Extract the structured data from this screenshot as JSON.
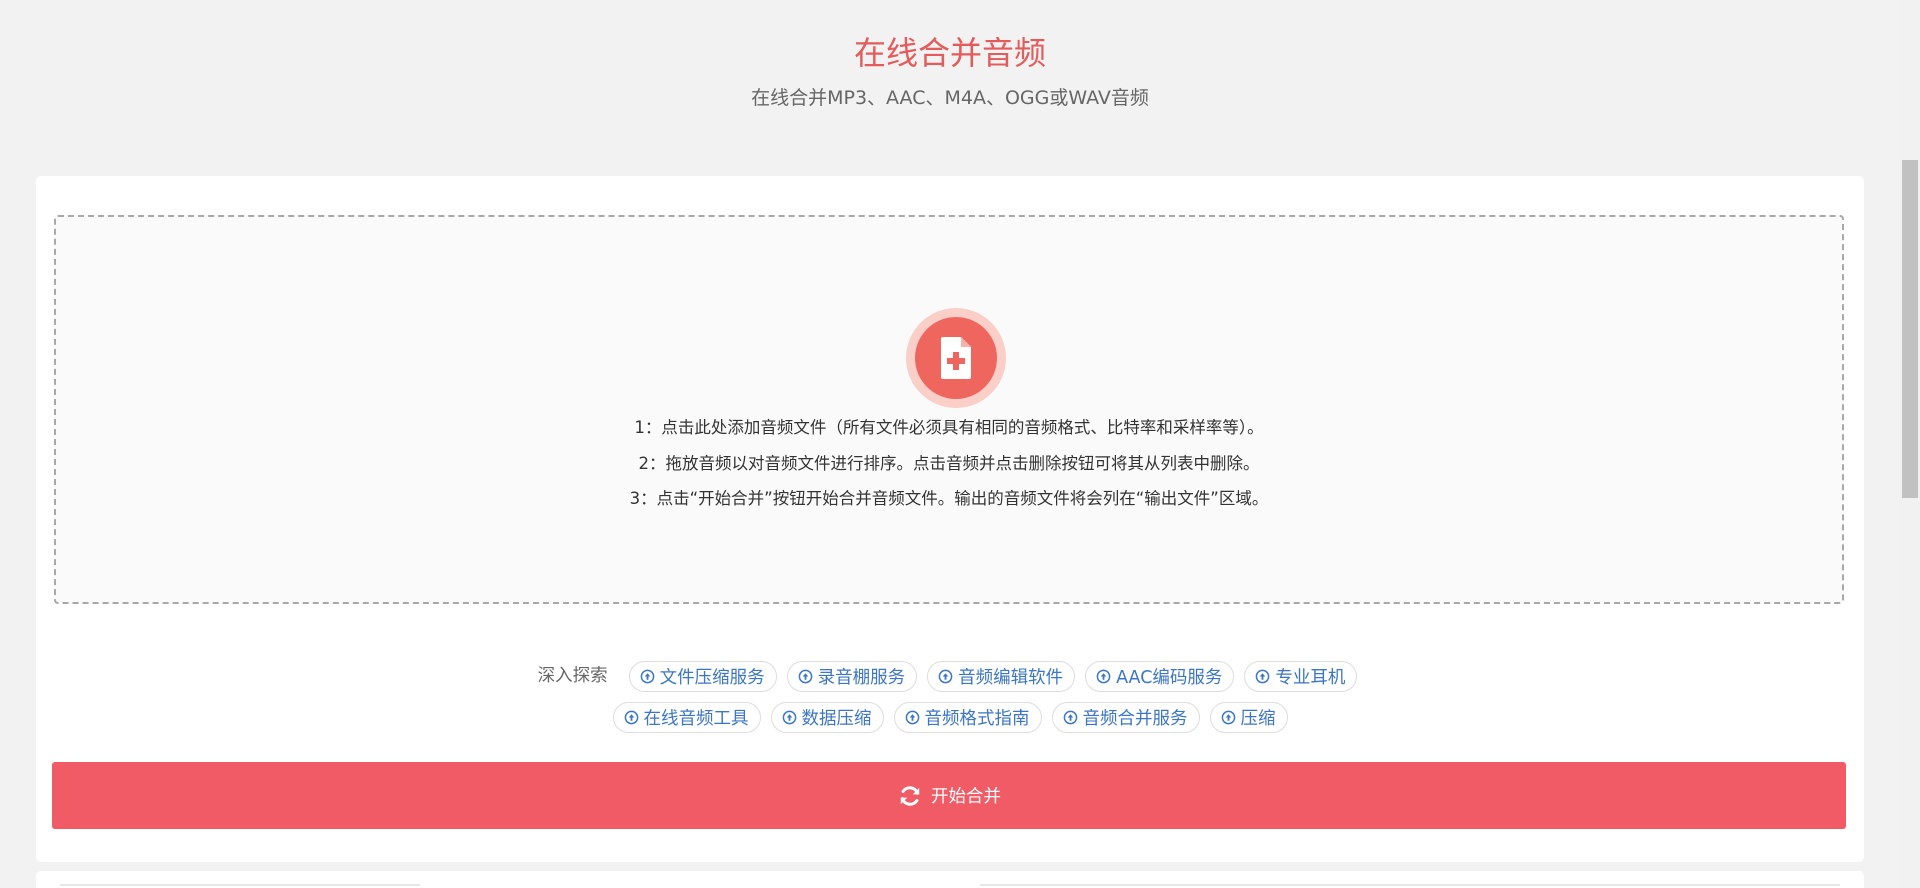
{
  "header": {
    "title": "在线合并音频",
    "subtitle": "在线合并MP3、AAC、M4A、OGG或WAV音频"
  },
  "dropzone": {
    "icon": "file-add-icon",
    "instructions": [
      "1：点击此处添加音频文件（所有文件必须具有相同的音频格式、比特率和采样率等）。",
      "2：拖放音频以对音频文件进行排序。点击音频并点击删除按钮可将其从列表中删除。",
      "3：点击“开始合并”按钮开始合并音频文件。输出的音频文件将会列在“输出文件”区域。"
    ]
  },
  "explore": {
    "label": "深入探索",
    "chips": [
      "文件压缩服务",
      "录音棚服务",
      "音频编辑软件",
      "AAC编码服务",
      "专业耳机",
      "在线音频工具",
      "数据压缩",
      "音频格式指南",
      "音频合并服务",
      "压缩"
    ]
  },
  "actions": {
    "start_label": "开始合并"
  },
  "colors": {
    "accent": "#e55a5a",
    "button": "#f15b66",
    "link": "#3c76c4",
    "icon_circle": "#ef665f",
    "icon_ring": "#f9cfc7"
  }
}
